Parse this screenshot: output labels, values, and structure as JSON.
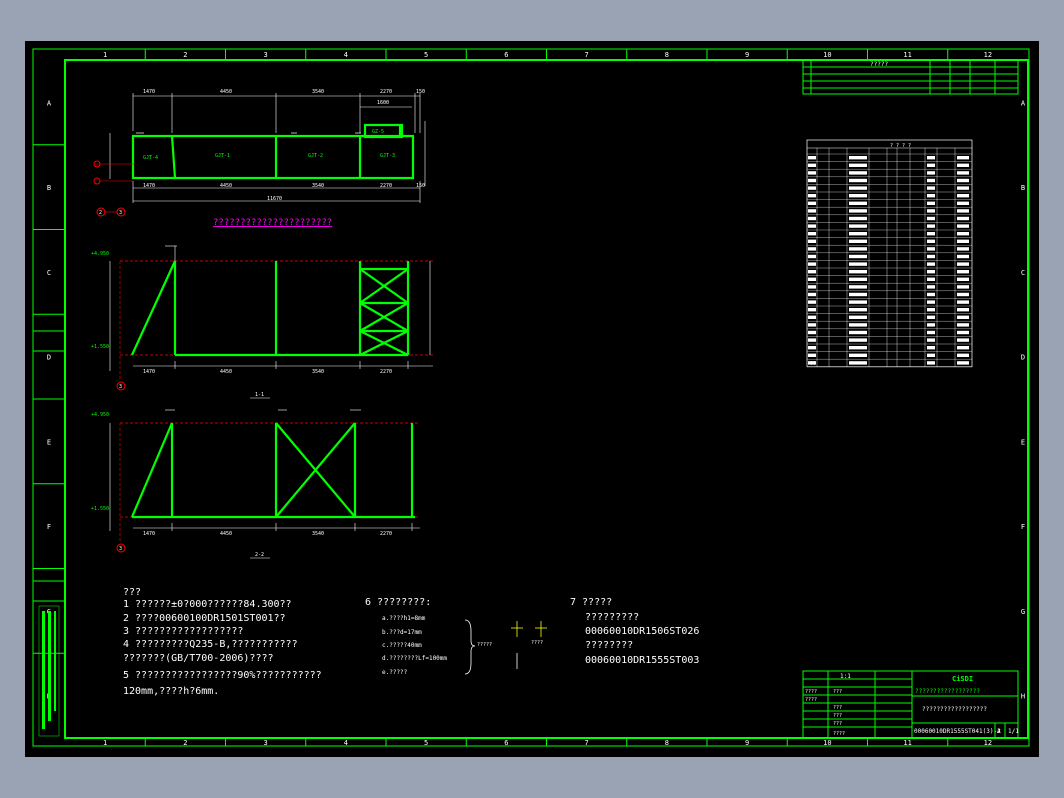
{
  "frame": {
    "col_numbers": [
      "1",
      "2",
      "3",
      "4",
      "5",
      "6",
      "7",
      "8",
      "9",
      "10",
      "11",
      "12"
    ],
    "row_letters": [
      "A",
      "B",
      "C",
      "D",
      "E",
      "F",
      "G",
      "H"
    ]
  },
  "colors": {
    "frame": "#00ff00",
    "line": "#ffffff",
    "member": "#00ff00",
    "axis": "#ff0000",
    "title": "#ff00ff",
    "accent": "#ffff00"
  },
  "plan": {
    "title": "??????????????????????",
    "dims_top": [
      "1470",
      "4450",
      "3540",
      "2270",
      "150"
    ],
    "dims_bottom": [
      "1470",
      "4450",
      "3540",
      "2270",
      "150"
    ],
    "total": "11670",
    "inset_dim": "1600",
    "members": [
      "GJT-4",
      "GJT-1",
      "GJT-2",
      "GJT-3",
      "GZ-5"
    ],
    "marks": [
      "2",
      "3"
    ]
  },
  "elev1": {
    "caption": "1-1",
    "level_top": "+4.950",
    "level_bottom": "+1.550",
    "dims_bottom": [
      "1470",
      "4450",
      "3540",
      "2270"
    ],
    "mark": "3"
  },
  "elev2": {
    "caption": "2-2",
    "level_top": "+4.950",
    "level_bottom": "+1.550",
    "dims_bottom": [
      "1470",
      "4450",
      "3540",
      "2270"
    ],
    "mark": "3"
  },
  "notes": {
    "heading": "???",
    "items": [
      "1    ??????±0?000??????84.300??",
      "2    ????00600100DR1501ST001??",
      "3    ??????????????????",
      "4    ?????????Q235-B,???????????",
      "       ???????(GB/T700-2006)????",
      "5    ?????????????????90%???????????",
      "       120mm,????h?6mm."
    ]
  },
  "weld": {
    "heading": "6  ????????:",
    "items": [
      "a.????h1=8mm",
      "b.???d=17mm",
      "c.?????40mm",
      "d.????????Lf=100mm",
      "e.?????"
    ],
    "brace_label": "?????",
    "sym_label": "????"
  },
  "refs": {
    "heading": "7  ?????",
    "items": [
      "?????????",
      "00060010DR1506ST026",
      "????????",
      "00060010DR1555ST003"
    ]
  },
  "revision_header": "?????",
  "title_block": {
    "company_code": "CiSDI",
    "company": "??????????????????",
    "scale": "1:1",
    "drawing_name": "??????????????????",
    "drawing_no": "00060010DR1555ST041(3)-2",
    "rev": "A",
    "sheet": "1/1",
    "left_rows": [
      "????",
      "????",
      "???",
      "???",
      "???",
      "???",
      "????"
    ]
  },
  "material_table": {
    "title": "? ? ? ?",
    "rows": 28,
    "total_label": "??"
  }
}
